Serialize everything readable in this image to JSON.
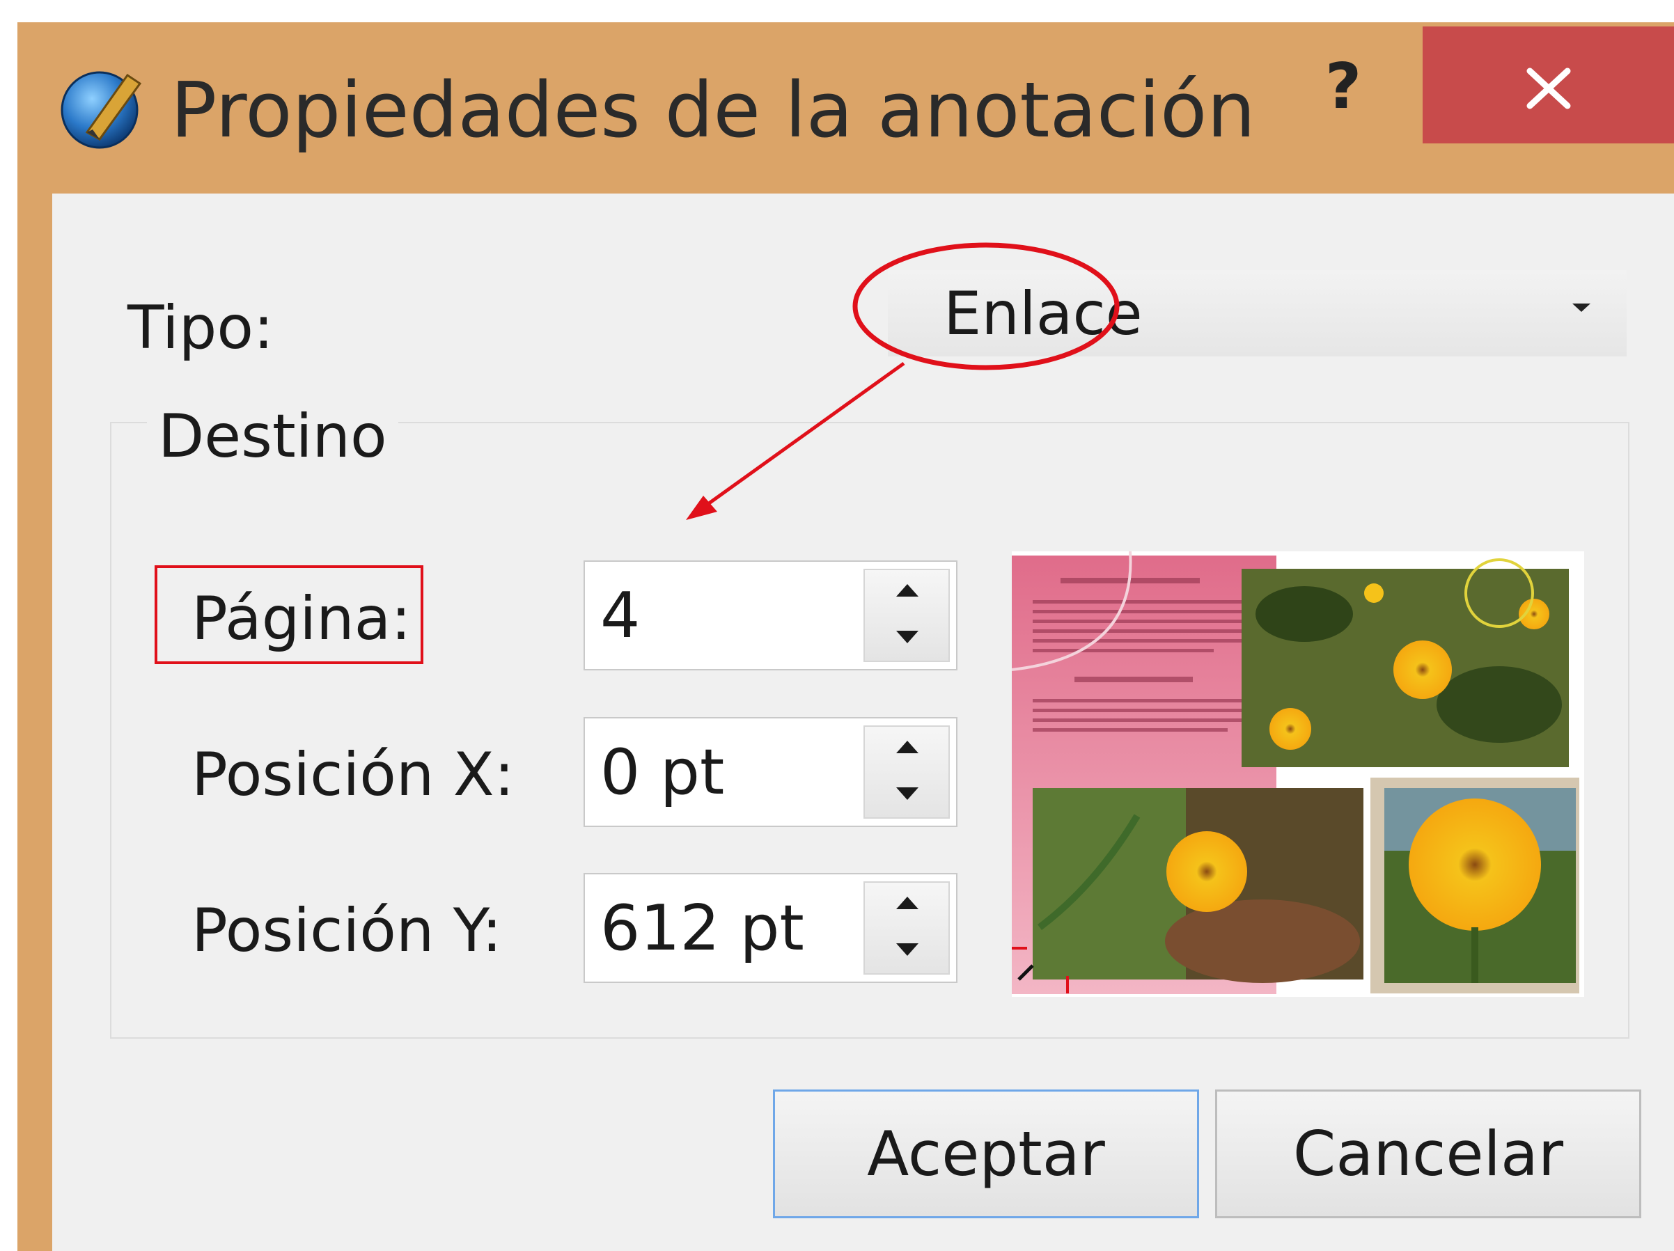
{
  "dialog": {
    "title": "Propiedades de la anotación",
    "help_label": "?",
    "close_label": "×"
  },
  "form": {
    "type_label": "Tipo:",
    "type_value": "Enlace",
    "group_title": "Destino",
    "page_label": "Página:",
    "page_value": "4",
    "x_label": "Posición X:",
    "x_value": "0 pt",
    "y_label": "Posición Y:",
    "y_value": "612 pt"
  },
  "buttons": {
    "ok_label": "Aceptar",
    "cancel_label": "Cancelar"
  },
  "colors": {
    "window_frame": "#dba468",
    "close_button": "#c84b4b",
    "client_bg": "#f0f0f0",
    "annotation_red": "#e0101a",
    "default_button_border": "#6fa7e8"
  },
  "icons": {
    "app": "pen-globe-icon",
    "combo_arrow": "chevron-down-icon",
    "spin_up": "arrow-up-icon",
    "spin_down": "arrow-down-icon"
  }
}
